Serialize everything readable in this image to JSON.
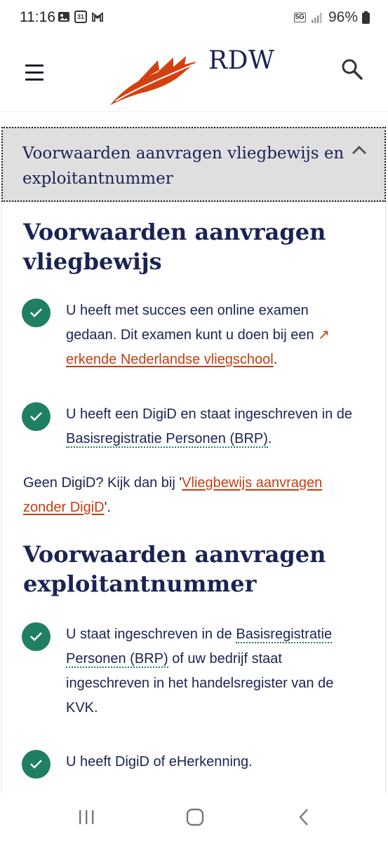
{
  "status": {
    "time": "11:16",
    "calendar_day": "31",
    "network": "5G",
    "battery": "96%"
  },
  "header": {
    "brand": "RDW",
    "logo_color": "#d4410f"
  },
  "accordion": {
    "title": "Voorwaarden aanvragen vliegbewijs en exploitantnummer"
  },
  "section1": {
    "heading": "Voorwaarden aanvragen vliegbewijs",
    "item1": {
      "text": "U heeft met succes een online examen gedaan. Dit examen kunt u doen bij een",
      "link": "erkende Nederlandse vliegschool",
      "suffix": "."
    },
    "item2": {
      "prefix": "U heeft een DigiD en staat ingeschreven in de",
      "abbr": "Basisregistratie Personen (BRP)",
      "suffix": "."
    },
    "note": {
      "prefix": "Geen DigiD? Kijk dan bij '",
      "link": "Vliegbewijs aanvragen zonder DigiD",
      "suffix": "'."
    }
  },
  "section2": {
    "heading": "Voorwaarden aanvragen exploitantnummer",
    "item1": {
      "prefix": "U staat ingeschreven in de",
      "abbr": "Basisregistratie Personen (BRP)",
      "suffix": "of uw bedrijf staat ingeschreven in het handelsregister van de KVK."
    },
    "item2": {
      "text": "U heeft DigiD of eHerkenning."
    }
  },
  "colors": {
    "accent_green": "#1f7f63",
    "link": "#c63d12",
    "text": "#1a2353"
  }
}
